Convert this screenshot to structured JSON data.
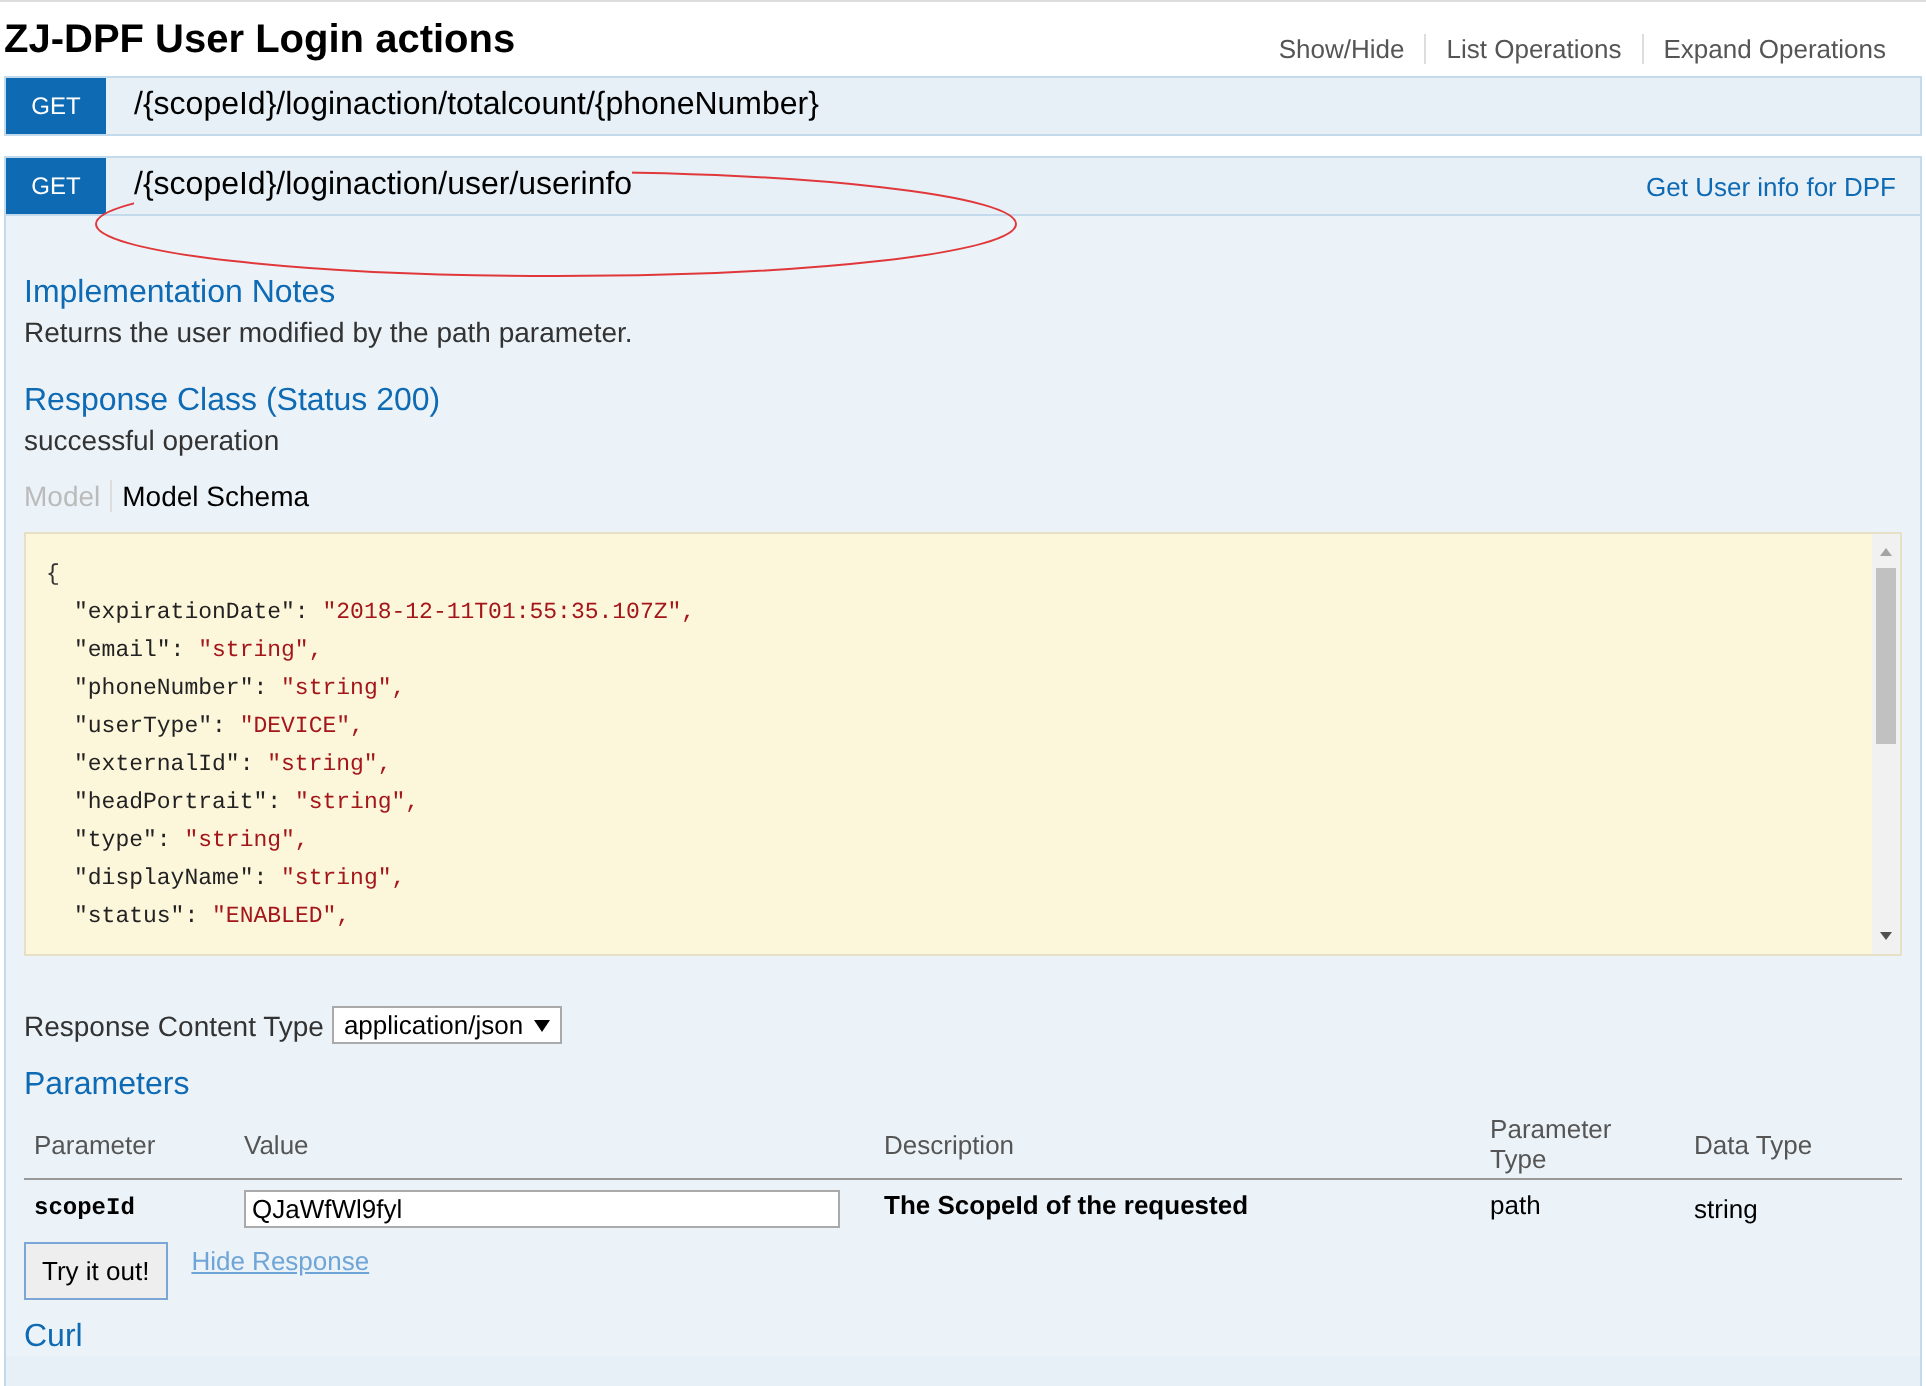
{
  "title": "ZJ-DPF User Login actions",
  "header_links": [
    "Show/Hide",
    "List Operations",
    "Expand Operations"
  ],
  "operations": [
    {
      "method": "GET",
      "path": "/{scopeId}/loginaction/totalcount/{phoneNumber}",
      "expanded": false
    },
    {
      "method": "GET",
      "path": "/{scopeId}/loginaction/user/userinfo",
      "summary": "Get User info for DPF",
      "expanded": true
    }
  ],
  "implementation_notes": {
    "heading": "Implementation Notes",
    "text": "Returns the user modified by the path parameter."
  },
  "response_class": {
    "heading": "Response Class (Status 200)",
    "text": "successful operation"
  },
  "model_tabs": [
    {
      "label": "Model",
      "selected": false
    },
    {
      "label": "Model Schema",
      "selected": true
    }
  ],
  "schema": {
    "open": "{",
    "lines": [
      {
        "key": "\"expirationDate\":",
        "value": "\"2018-12-11T01:55:35.107Z\","
      },
      {
        "key": "\"email\":",
        "value": "\"string\","
      },
      {
        "key": "\"phoneNumber\":",
        "value": "\"string\","
      },
      {
        "key": "\"userType\":",
        "value": "\"DEVICE\","
      },
      {
        "key": "\"externalId\":",
        "value": "\"string\","
      },
      {
        "key": "\"headPortrait\":",
        "value": "\"string\","
      },
      {
        "key": "\"type\":",
        "value": "\"string\","
      },
      {
        "key": "\"displayName\":",
        "value": "\"string\","
      },
      {
        "key": "\"status\":",
        "value": "\"ENABLED\","
      }
    ]
  },
  "response_content_type": {
    "label": "Response Content Type",
    "value": "application/json"
  },
  "parameters": {
    "heading": "Parameters",
    "columns": [
      "Parameter",
      "Value",
      "Description",
      "Parameter Type",
      "Data Type"
    ],
    "rows": [
      {
        "name": "scopeId",
        "value": "QJaWfWl9fyl",
        "description": "The ScopeId of the requested",
        "param_type": "path",
        "data_type": "string"
      }
    ]
  },
  "try_button": "Try it out!",
  "hide_response": "Hide Response",
  "curl_heading": "Curl"
}
